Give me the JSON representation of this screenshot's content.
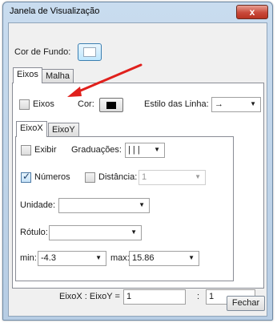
{
  "window": {
    "title": "Janela de Visualização",
    "close_glyph": "x"
  },
  "background": {
    "label": "Cor de Fundo:",
    "color": "#ffffff"
  },
  "main_tabs": [
    {
      "label": "Eixos",
      "active": true
    },
    {
      "label": "Malha",
      "active": false
    }
  ],
  "axes": {
    "show_label": "Eixos",
    "show_checked": false,
    "color_label": "Cor:",
    "color": "#000000",
    "line_style_label": "Estilo das Linha:",
    "line_style_value": "→"
  },
  "axis_tabs": [
    {
      "label": "EixoX",
      "active": true
    },
    {
      "label": "EixoY",
      "active": false
    }
  ],
  "axis_x": {
    "show_label": "Exibir",
    "show_checked": false,
    "ticks_label": "Graduações:",
    "ticks_value": "| | |",
    "numbers_label": "Números",
    "numbers_checked": true,
    "distance_label": "Distância:",
    "distance_checked": false,
    "distance_value": "1",
    "unit_label": "Unidade:",
    "unit_value": "",
    "label_label": "Rótulo:",
    "label_value": "",
    "min_label": "min:",
    "min_value": "-4.3",
    "max_label": "max:",
    "max_value": "15.86"
  },
  "ratio": {
    "label": "EixoX : EixoY =",
    "x_value": "1",
    "separator": ":",
    "y_value": "1"
  },
  "footer": {
    "close_label": "Fechar"
  },
  "annotation": {
    "arrow_color": "#e0201c"
  }
}
